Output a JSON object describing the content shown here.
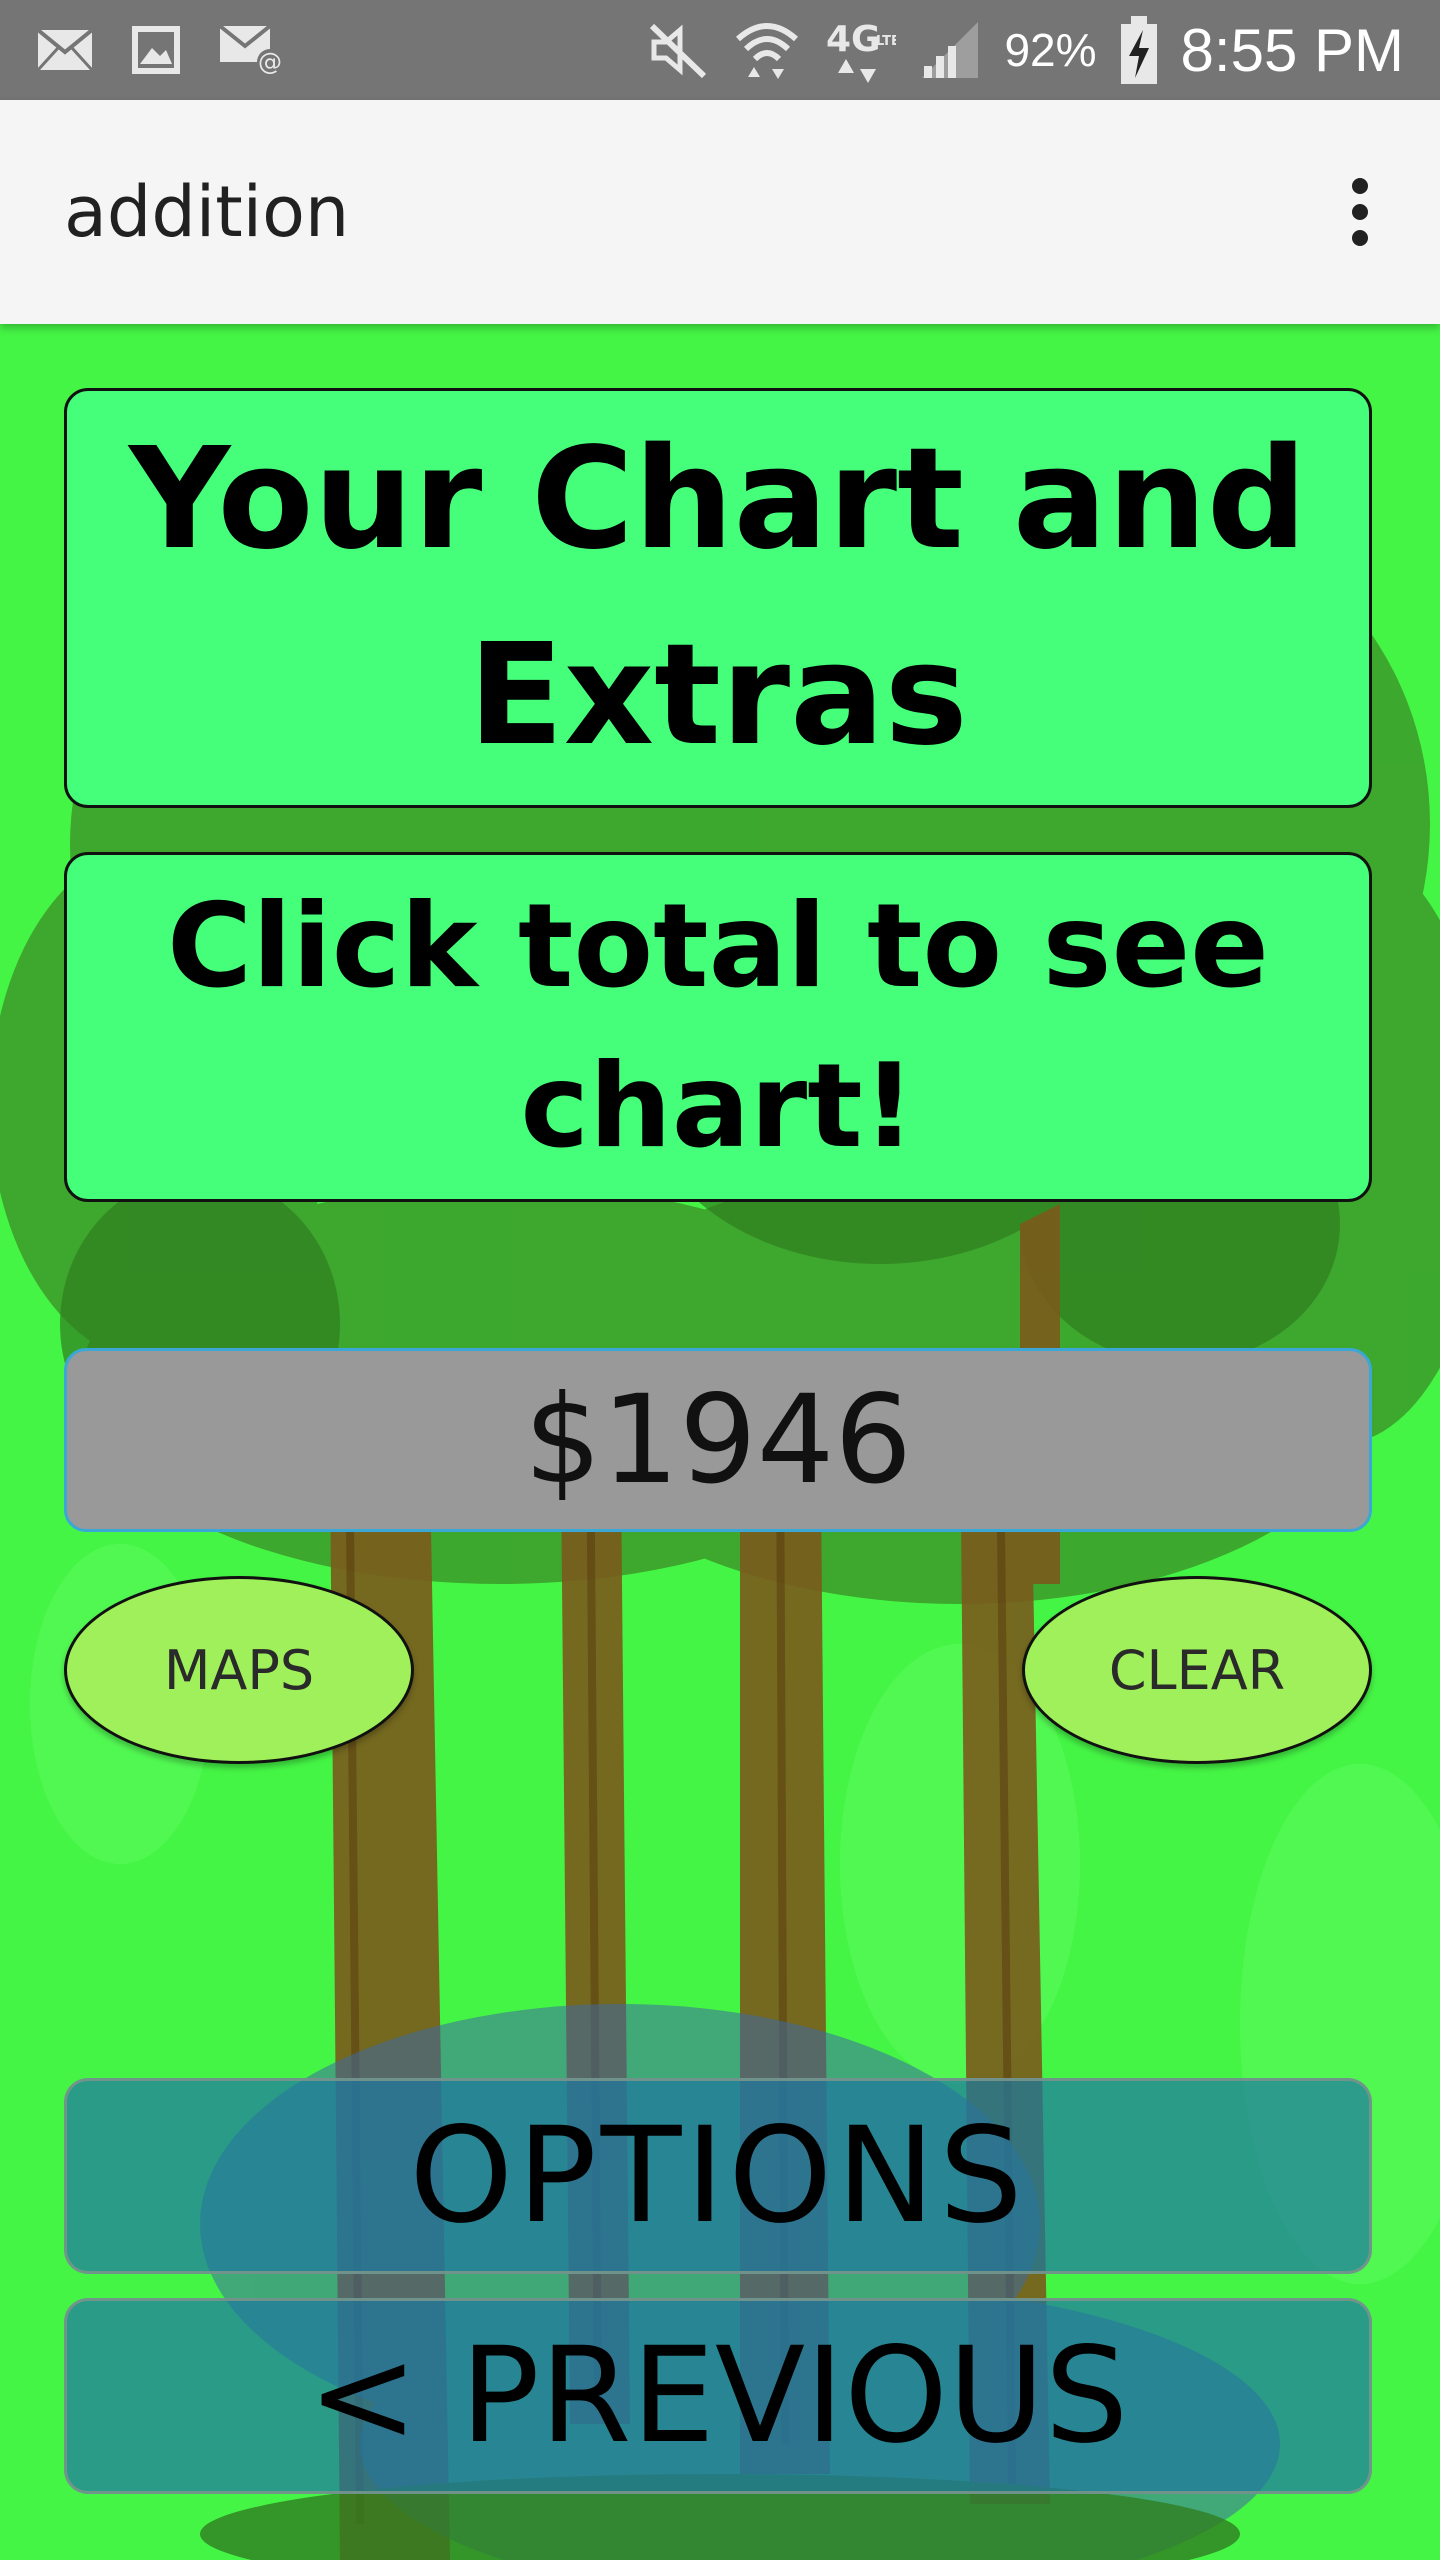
{
  "status_bar": {
    "battery": "92%",
    "time": "8:55 PM",
    "network": "4G LTE",
    "icons": [
      "mail-icon",
      "image-icon",
      "email-notification-icon",
      "mute-icon",
      "wifi-icon",
      "4g-lte-icon",
      "signal-icon",
      "battery-charging-icon"
    ]
  },
  "app_bar": {
    "title": "addition",
    "menu_icon": "overflow-menu-icon"
  },
  "main": {
    "heading": "Your Chart and Extras",
    "hint": "Click total to see chart!",
    "total": "$1946",
    "maps_label": "MAPS",
    "clear_label": "CLEAR",
    "options_label": "OPTIONS",
    "previous_label": "< PREVIOUS"
  },
  "colors": {
    "background": "#45f545",
    "card": "#45ff7a",
    "total_field": "#999999",
    "oval_button": "#9ff05a",
    "bottom_button": "#1e78a0"
  }
}
